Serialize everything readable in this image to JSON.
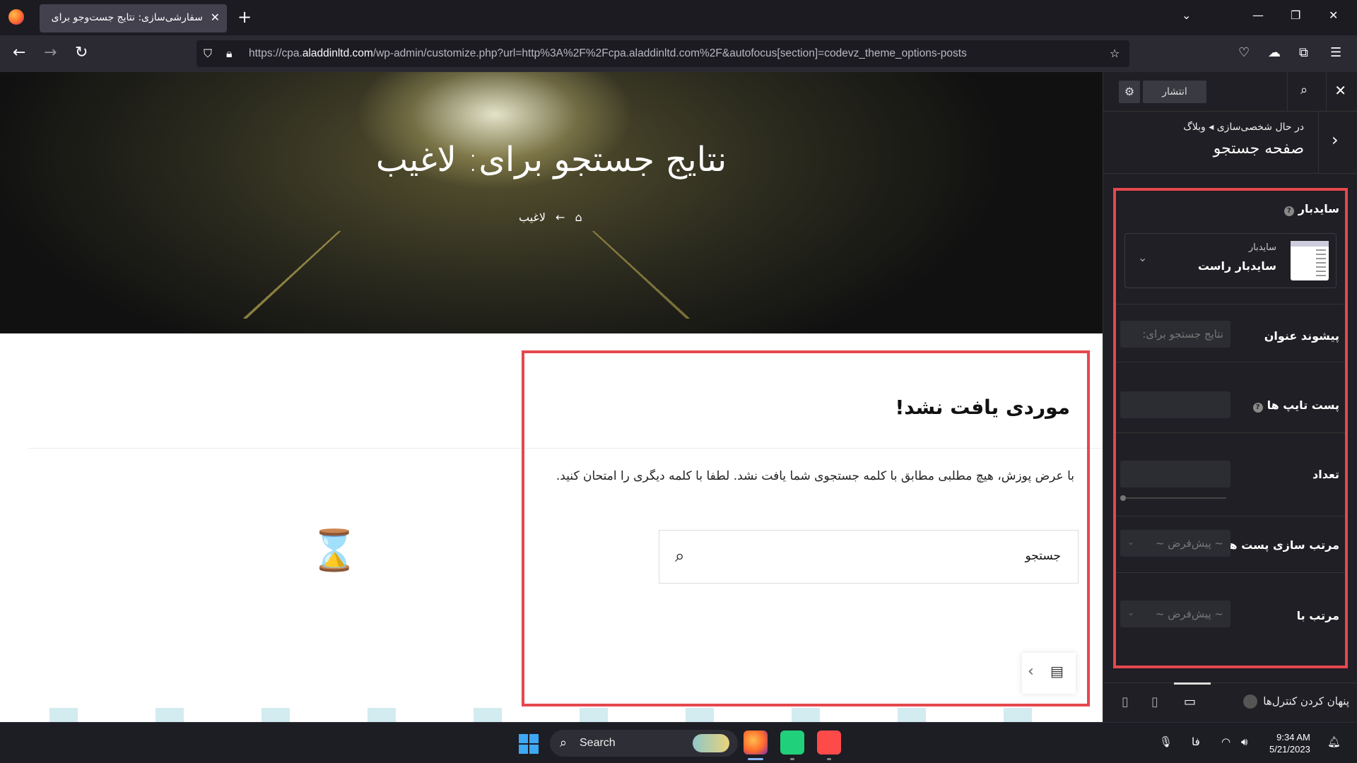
{
  "browser": {
    "tab_title": "سفارشی‌سازی: نتایج جست‌وجو برای \"لا",
    "url_prefix": "https://cpa.",
    "url_domain": "aladdinltd.com",
    "url_rest": "/wp-admin/customize.php?url=http%3A%2F%2Fcpa.aladdinltd.com%2F&autofocus[section]=codevz_theme_options-posts",
    "icons": [
      "back-arrow-icon",
      "forward-arrow-icon",
      "reload-icon",
      "shield-icon",
      "lock-icon",
      "star-icon",
      "pocket-icon",
      "extensions-icon",
      "menu-icon"
    ]
  },
  "preview": {
    "hero_title": "نتایج جستجو برای: لاغیب",
    "breadcrumb_current": "لاغیب",
    "not_found_title": "موردی یافت نشد!",
    "not_found_text": "با عرض پوزش، هیچ مطلبی مطابق با کلمه جستجوی شما یافت نشد. لطفا با کلمه دیگری را امتحان کنید.",
    "search_label": "جستجو"
  },
  "customizer": {
    "publish_label": "انتشار",
    "breadcrumb": "در حال شخصی‌سازی ◂ وبلاگ",
    "section_title": "صفحه جستجو",
    "sidebar_label": "سایدبار",
    "sidebar_card_small": "سایدبار",
    "sidebar_card_value": "سایدبار راست",
    "title_prefix_label": "پیشوند عنوان",
    "title_prefix_placeholder": "نتایج جستجو برای:",
    "post_types_label": "پست تایپ ها",
    "count_label": "تعداد",
    "count_fraction": 0,
    "order_by_label": "مرتب سازی پست ها",
    "order_by_value": "~ پیش‌فرض ~",
    "order_label": "مرتب با",
    "order_value": "~ پیش‌فرض ~",
    "hide_controls_label": "پنهان کردن کنترل‌ها"
  },
  "taskbar": {
    "search_label": "Search",
    "lang": "فا",
    "time": "9:34 AM",
    "date": "5/21/2023"
  },
  "colors": {
    "highlight": "#e5484d",
    "panel_bg": "#1f1f25"
  }
}
